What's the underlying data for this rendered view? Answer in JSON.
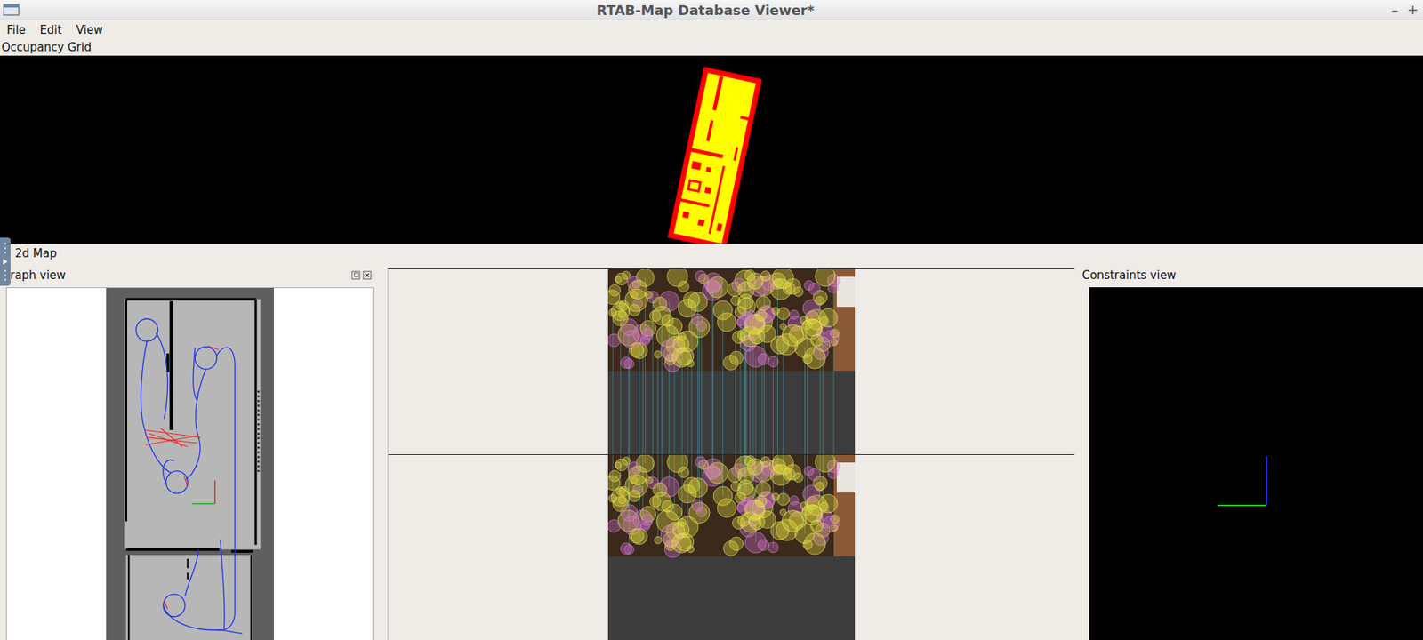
{
  "window": {
    "title": "RTAB-Map Database Viewer*",
    "controls": [
      "–",
      "+"
    ]
  },
  "menu": [
    {
      "label": "File"
    },
    {
      "label": "Edit"
    },
    {
      "label": "View"
    }
  ],
  "docks": {
    "occupancy_grid": {
      "title": "Occupancy Grid"
    },
    "map_2d": {
      "title": "2d Map"
    },
    "graph_view": {
      "title": "Graph view"
    },
    "constraints_view": {
      "title": "Constraints view"
    }
  }
}
